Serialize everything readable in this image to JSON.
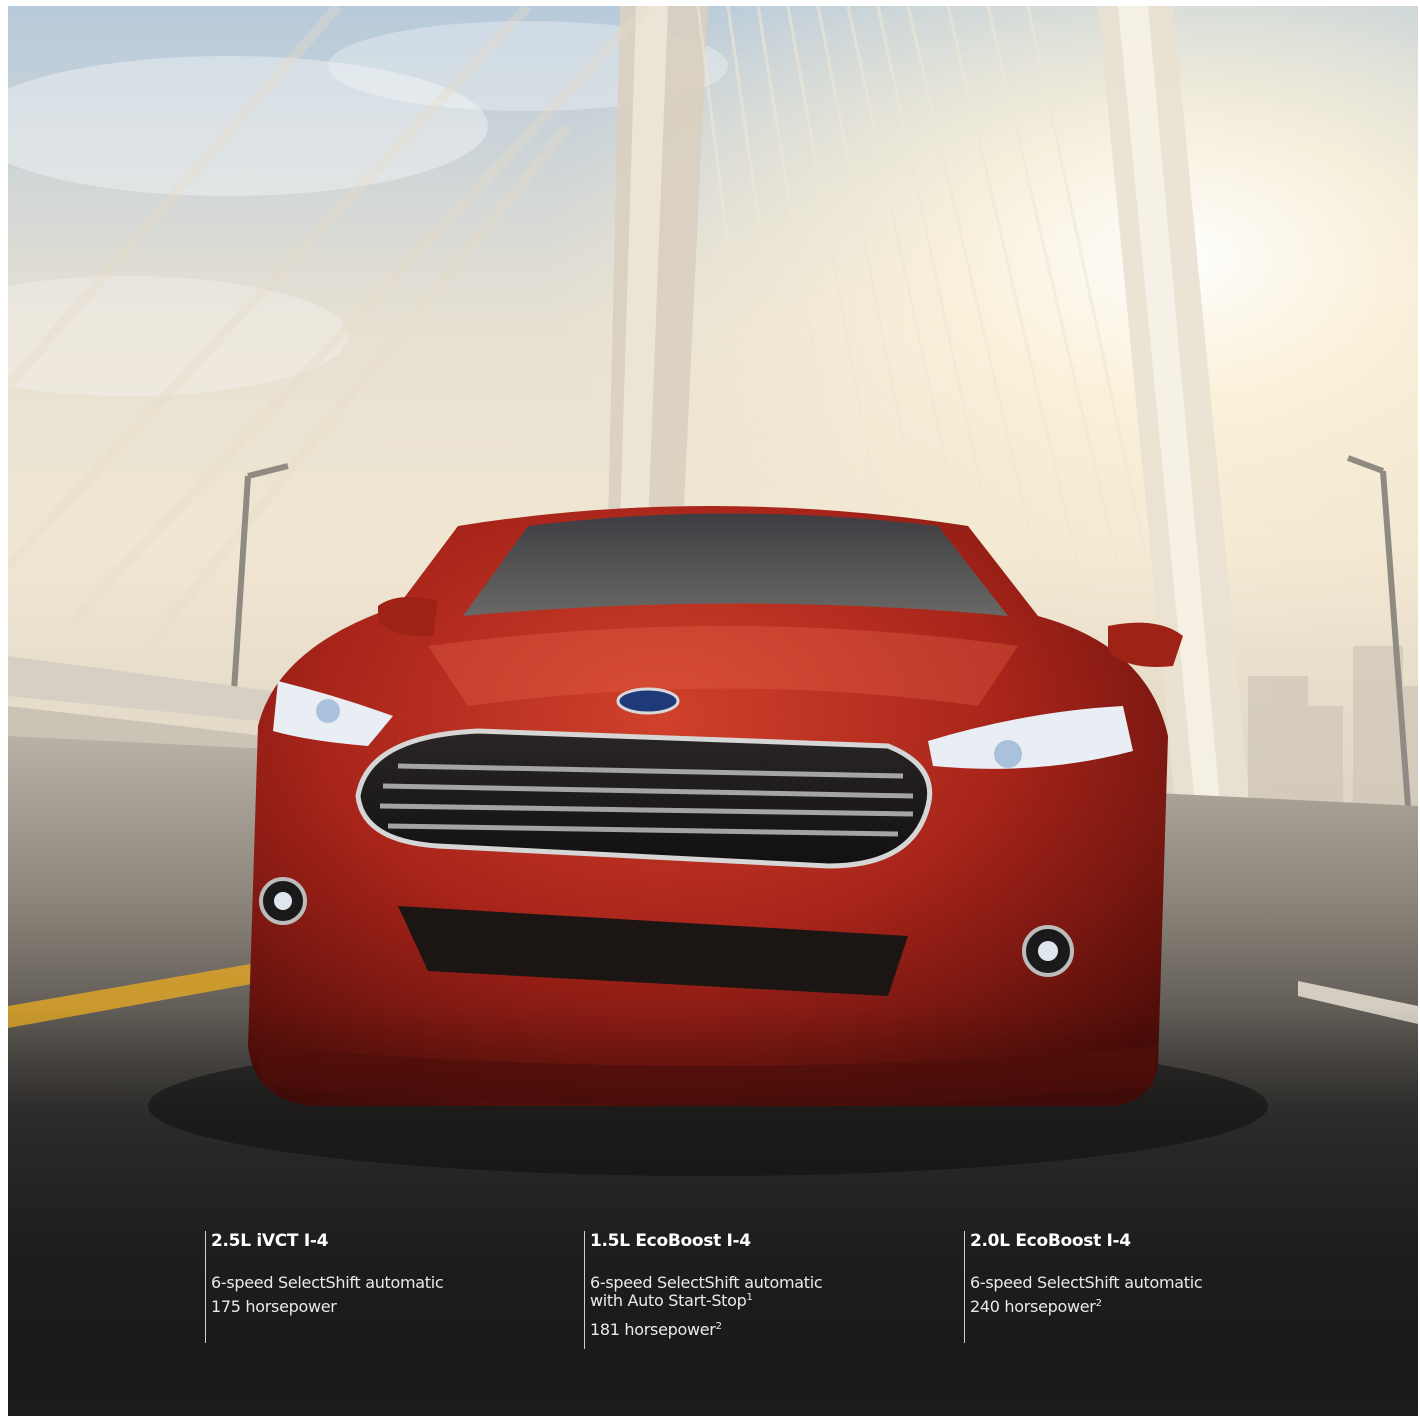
{
  "engines": [
    {
      "name": "2.5L iVCT I-4",
      "transmission": "6-speed SelectShift automatic",
      "horsepower": "175 horsepower",
      "horsepower_note": ""
    },
    {
      "name": "1.5L EcoBoost I-4",
      "transmission": "6-speed SelectShift automatic",
      "transmission_extra": "with Auto Start-Stop",
      "transmission_note": "1",
      "horsepower": "181 horsepower",
      "horsepower_note": "2"
    },
    {
      "name": "2.0L EcoBoost I-4",
      "transmission": "6-speed SelectShift automatic",
      "horsepower": "240 horsepower",
      "horsepower_note": "2"
    }
  ],
  "colors": {
    "car_body": "#b0241a",
    "sky_top": "#b9cde0",
    "sun_glow": "#fff6e2",
    "road": "#1e1e1e",
    "text": "#f2f2f2"
  }
}
